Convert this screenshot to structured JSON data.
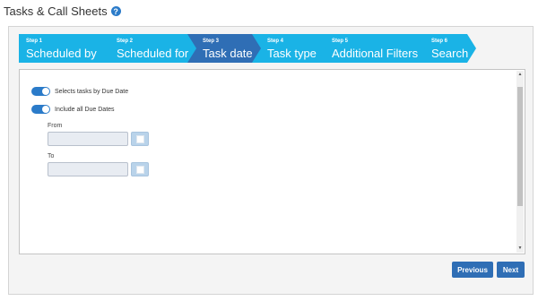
{
  "page": {
    "title": "Tasks & Call Sheets",
    "help_icon": "?"
  },
  "wizard": {
    "steps": [
      {
        "num": "Step 1",
        "name": "Scheduled by"
      },
      {
        "num": "Step 2",
        "name": "Scheduled for"
      },
      {
        "num": "Step 3",
        "name": "Task date"
      },
      {
        "num": "Step 4",
        "name": "Task type"
      },
      {
        "num": "Step 5",
        "name": "Additional Filters"
      },
      {
        "num": "Step 6",
        "name": "Search"
      }
    ],
    "active_step": 3,
    "colors": {
      "step": "#1ab3e6",
      "active_step": "#2f6eb5"
    }
  },
  "form": {
    "toggle_due_date": {
      "label": "Selects tasks by Due Date",
      "on": true
    },
    "toggle_all_dates": {
      "label": "Include all Due Dates",
      "on": true
    },
    "from": {
      "label": "From",
      "value": ""
    },
    "to": {
      "label": "To",
      "value": ""
    }
  },
  "buttons": {
    "previous": "Previous",
    "next": "Next"
  }
}
